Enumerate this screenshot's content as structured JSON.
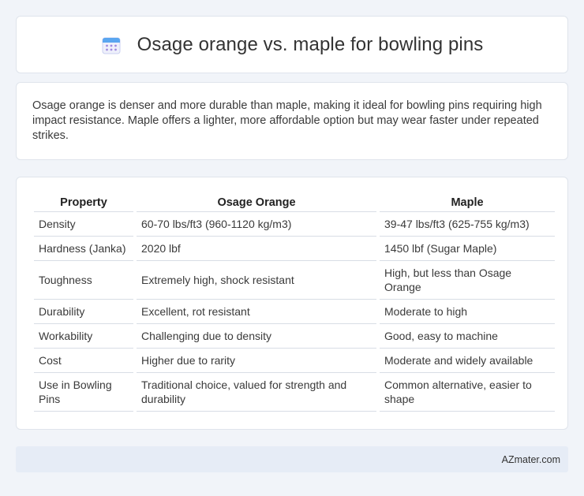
{
  "header": {
    "title": "Osage orange vs. maple for bowling pins",
    "icon": "calendar-icon"
  },
  "summary": {
    "text": "Osage orange is denser and more durable than maple, making it ideal for bowling pins requiring high impact resistance. Maple offers a lighter, more affordable option but may wear faster under repeated strikes."
  },
  "table": {
    "headers": [
      "Property",
      "Osage Orange",
      "Maple"
    ],
    "rows": [
      [
        "Density",
        "60-70 lbs/ft3 (960-1120 kg/m3)",
        "39-47 lbs/ft3 (625-755 kg/m3)"
      ],
      [
        "Hardness (Janka)",
        "2020 lbf",
        "1450 lbf (Sugar Maple)"
      ],
      [
        "Toughness",
        "Extremely high, shock resistant",
        "High, but less than Osage Orange"
      ],
      [
        "Durability",
        "Excellent, rot resistant",
        "Moderate to high"
      ],
      [
        "Workability",
        "Challenging due to density",
        "Good, easy to machine"
      ],
      [
        "Cost",
        "Higher due to rarity",
        "Moderate and widely available"
      ],
      [
        "Use in Bowling Pins",
        "Traditional choice, valued for strength and durability",
        "Common alternative, easier to shape"
      ]
    ]
  },
  "footer": {
    "brand": "AZmater.com"
  }
}
